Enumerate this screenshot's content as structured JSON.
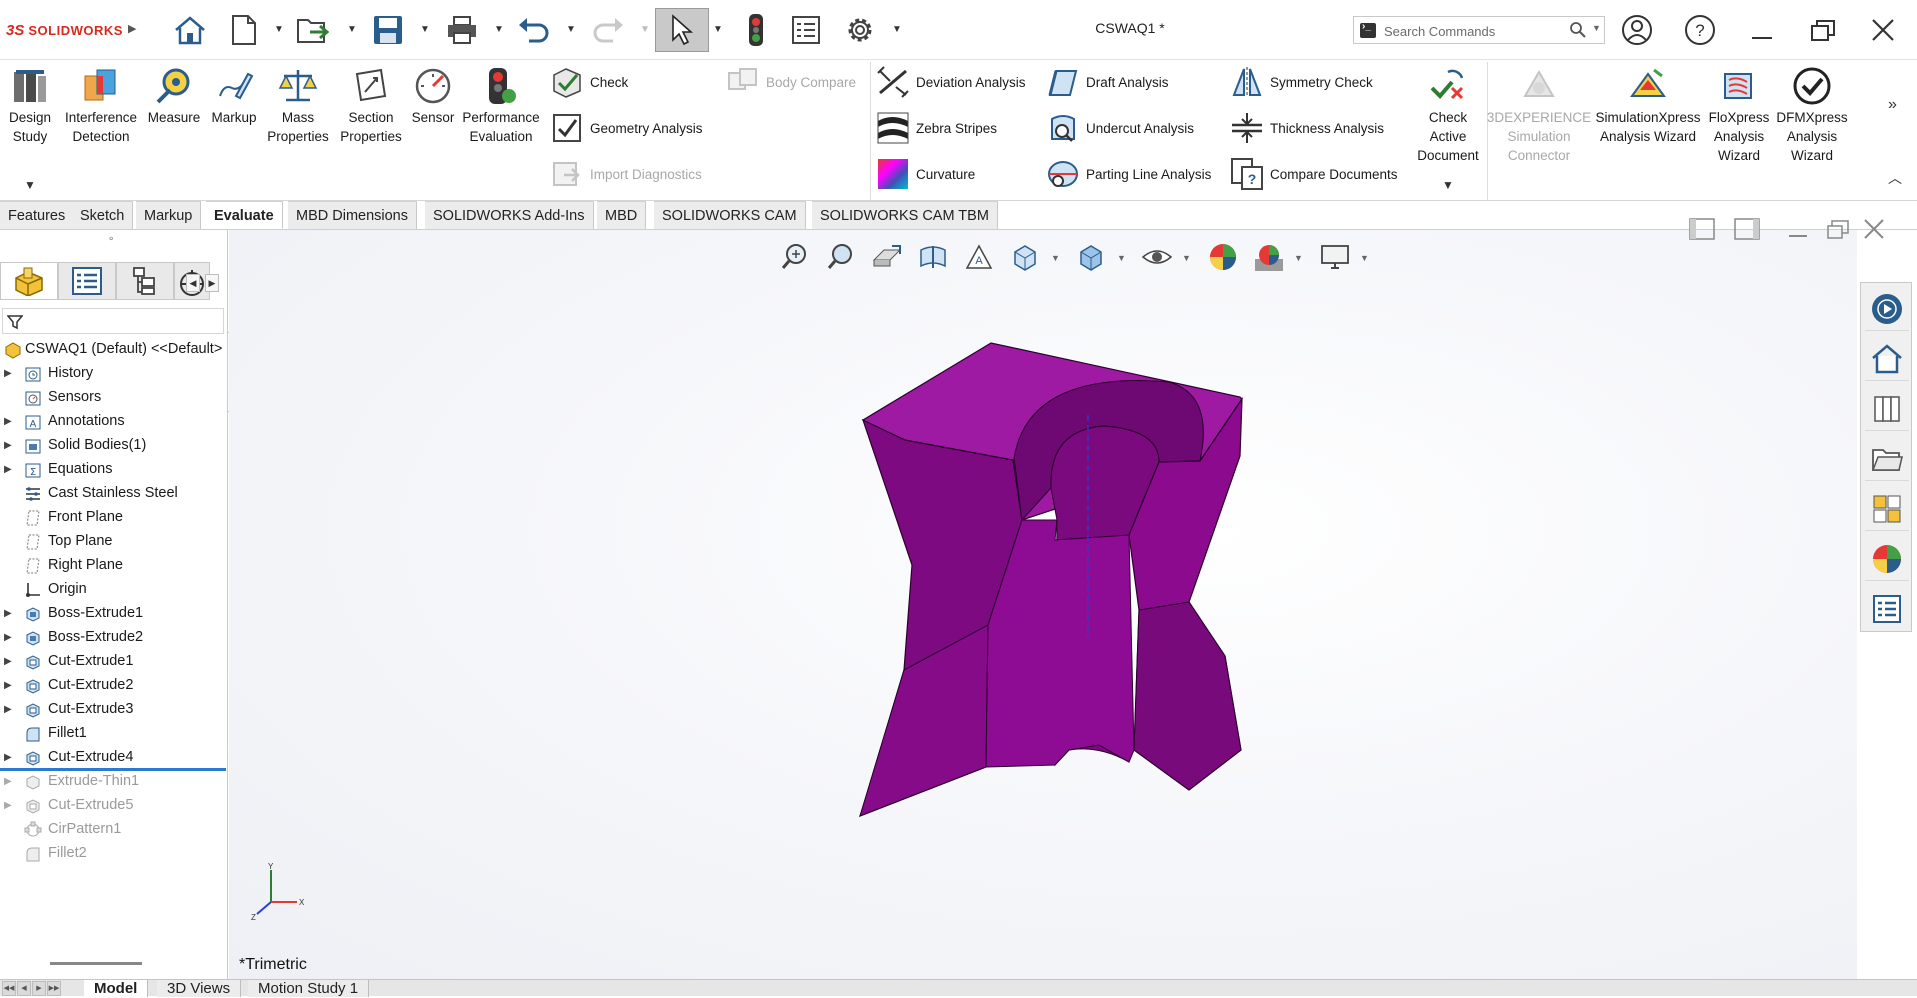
{
  "app": {
    "logo_ds": "3S",
    "logo_text": "SOLIDWORKS",
    "document_title": "CSWAQ1 *"
  },
  "search": {
    "placeholder": "Search Commands"
  },
  "ribbon": {
    "large_buttons": [
      {
        "label1": "Design",
        "label2": "Study",
        "icon": "design-study-icon"
      },
      {
        "label1": "Interference",
        "label2": "Detection",
        "icon": "interference-detection-icon"
      },
      {
        "label1": "Measure",
        "label2": "",
        "icon": "measure-icon"
      },
      {
        "label1": "Markup",
        "label2": "",
        "icon": "markup-icon"
      },
      {
        "label1": "Mass",
        "label2": "Properties",
        "icon": "mass-properties-icon"
      },
      {
        "label1": "Section",
        "label2": "Properties",
        "icon": "section-properties-icon"
      },
      {
        "label1": "Sensor",
        "label2": "",
        "icon": "sensor-icon"
      },
      {
        "label1": "Performance",
        "label2": "Evaluation",
        "icon": "performance-evaluation-icon"
      }
    ],
    "check_group": [
      {
        "label": "Check",
        "enabled": true
      },
      {
        "label": "Geometry Analysis",
        "enabled": true
      },
      {
        "label": "Import Diagnostics",
        "enabled": false
      },
      {
        "label": "Body Compare",
        "enabled": false
      }
    ],
    "analysis_col1": [
      "Deviation Analysis",
      "Zebra Stripes",
      "Curvature"
    ],
    "analysis_col2": [
      "Draft Analysis",
      "Undercut Analysis",
      "Parting Line Analysis"
    ],
    "analysis_col3": [
      "Symmetry Check",
      "Thickness Analysis",
      "Compare Documents"
    ],
    "check_active_document": {
      "l1": "Check",
      "l2": "Active",
      "l3": "Document"
    },
    "simulation_buttons": [
      {
        "l1": "3DEXPERIENCE",
        "l2": "Simulation",
        "l3": "Connector",
        "enabled": false
      },
      {
        "l1": "SimulationXpress",
        "l2": "Analysis Wizard",
        "l3": "",
        "enabled": true
      },
      {
        "l1": "FloXpress",
        "l2": "Analysis",
        "l3": "Wizard",
        "enabled": true
      },
      {
        "l1": "DFMXpress",
        "l2": "Analysis",
        "l3": "Wizard",
        "enabled": true
      }
    ]
  },
  "command_tabs": [
    "Features",
    "Sketch",
    "Markup",
    "Evaluate",
    "MBD Dimensions",
    "SOLIDWORKS Add-Ins",
    "MBD",
    "SOLIDWORKS CAM",
    "SOLIDWORKS CAM TBM"
  ],
  "active_command_tab": "Evaluate",
  "feature_tree": {
    "root": "CSWAQ1  (Default) <<Default>",
    "items": [
      {
        "label": "History",
        "expandable": true,
        "suppressed": false
      },
      {
        "label": "Sensors",
        "expandable": false,
        "suppressed": false
      },
      {
        "label": "Annotations",
        "expandable": true,
        "suppressed": false
      },
      {
        "label": "Solid Bodies(1)",
        "expandable": true,
        "suppressed": false
      },
      {
        "label": "Equations",
        "expandable": true,
        "suppressed": false
      },
      {
        "label": "Cast Stainless Steel",
        "expandable": false,
        "suppressed": false
      },
      {
        "label": "Front Plane",
        "expandable": false,
        "suppressed": false
      },
      {
        "label": "Top Plane",
        "expandable": false,
        "suppressed": false
      },
      {
        "label": "Right Plane",
        "expandable": false,
        "suppressed": false
      },
      {
        "label": "Origin",
        "expandable": false,
        "suppressed": false
      },
      {
        "label": "Boss-Extrude1",
        "expandable": true,
        "suppressed": false
      },
      {
        "label": "Boss-Extrude2",
        "expandable": true,
        "suppressed": false
      },
      {
        "label": "Cut-Extrude1",
        "expandable": true,
        "suppressed": false
      },
      {
        "label": "Cut-Extrude2",
        "expandable": true,
        "suppressed": false
      },
      {
        "label": "Cut-Extrude3",
        "expandable": true,
        "suppressed": false
      },
      {
        "label": "Fillet1",
        "expandable": false,
        "suppressed": false
      },
      {
        "label": "Cut-Extrude4",
        "expandable": true,
        "suppressed": false
      },
      {
        "label": "Extrude-Thin1",
        "expandable": true,
        "suppressed": true
      },
      {
        "label": "Cut-Extrude5",
        "expandable": true,
        "suppressed": true
      },
      {
        "label": "CirPattern1",
        "expandable": false,
        "suppressed": true
      },
      {
        "label": "Fillet2",
        "expandable": false,
        "suppressed": true
      }
    ]
  },
  "viewport": {
    "view_name": "*Trimetric",
    "model_color": "#8b0a8e",
    "triad": {
      "x": "X",
      "y": "Y",
      "z": "Z"
    }
  },
  "bottom_tabs": [
    "Model",
    "3D Views",
    "Motion Study 1"
  ],
  "active_bottom_tab": "Model"
}
